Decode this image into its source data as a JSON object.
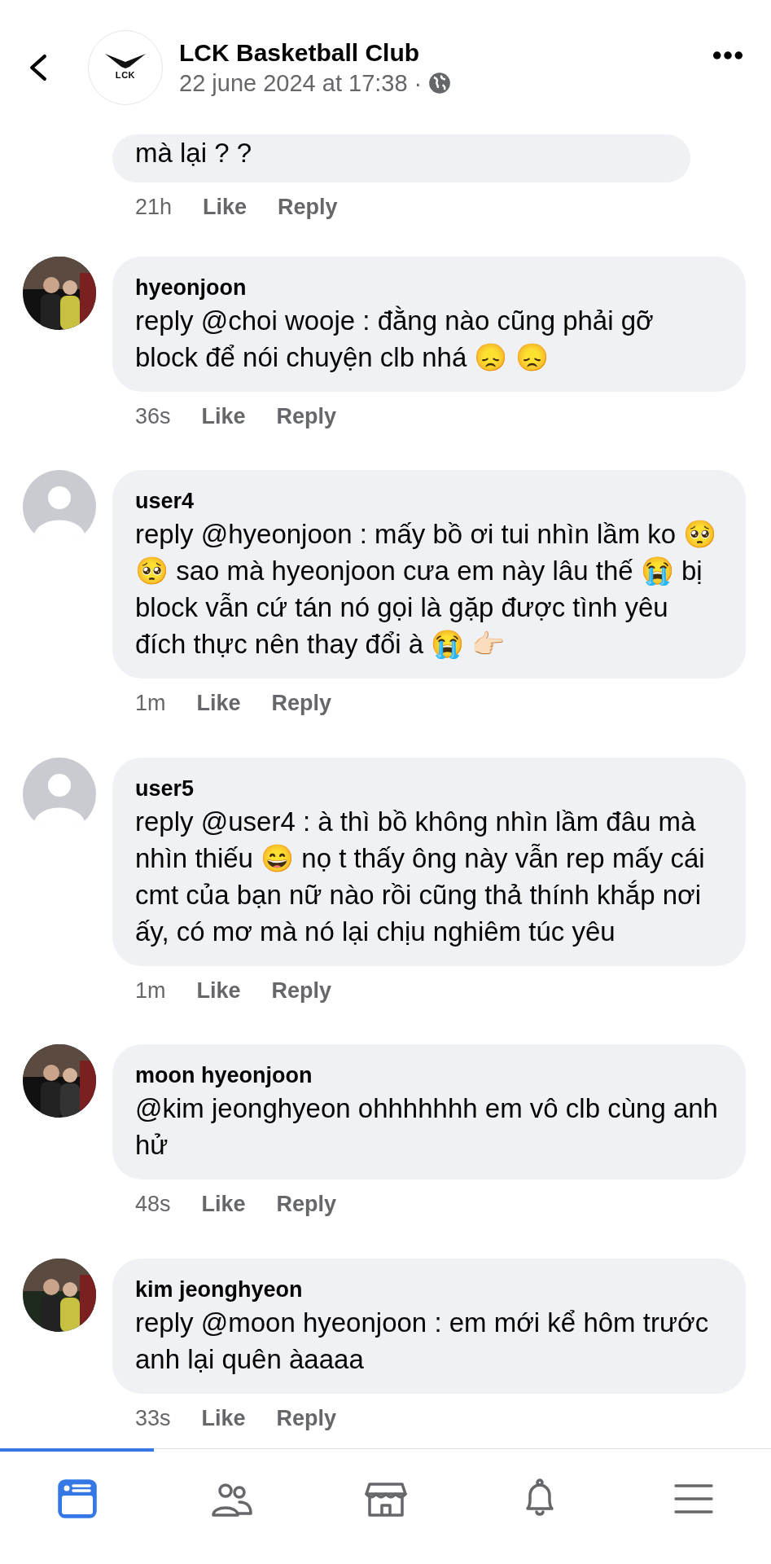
{
  "header": {
    "page_name": "LCK Basketball Club",
    "timestamp": "22 june 2024 at 17:38",
    "separator": "·",
    "logo_text": "LCK"
  },
  "comments": [
    {
      "kind": "continued",
      "text": "mà lại ? ?",
      "time": "21h",
      "like": "Like",
      "reply": "Reply"
    },
    {
      "kind": "photo_avatar",
      "name": "hyeonjoon",
      "text": "reply @choi wooje : đằng nào cũng phải gỡ block để nói chuyện clb nhá 😞 😞",
      "time": "36s",
      "like": "Like",
      "reply": "Reply"
    },
    {
      "kind": "default_avatar",
      "name": "user4",
      "text": "reply @hyeonjoon : mấy bồ ơi tui nhìn lầm ko 🥺 🥺  sao mà hyeonjoon cưa em này lâu thế 😭  bị block vẫn cứ tán nó gọi là gặp được tình yêu đích thực nên thay đổi à 😭 👉🏻",
      "time": "1m",
      "like": "Like",
      "reply": "Reply"
    },
    {
      "kind": "default_avatar",
      "name": "user5",
      "text": "reply @user4 : à thì bồ không nhìn lầm đâu mà nhìn thiếu 😄  nọ t thấy ông này vẫn rep mấy cái cmt của bạn nữ nào rồi cũng thả thính khắp nơi ấy, có mơ mà nó lại chịu nghiêm túc yêu",
      "time": "1m",
      "like": "Like",
      "reply": "Reply"
    },
    {
      "kind": "photo_avatar",
      "name": "moon hyeonjoon",
      "text": "@kim jeonghyeon ohhhhhhh em vô clb cùng anh hử",
      "time": "48s",
      "like": "Like",
      "reply": "Reply"
    },
    {
      "kind": "photo_avatar",
      "name": "kim jeonghyeon",
      "text": "reply @moon hyeonjoon : em mới kể hôm trước anh lại quên àaaaa",
      "time": "33s",
      "like": "Like",
      "reply": "Reply"
    }
  ],
  "tab_bar": [
    {
      "kind": "feed",
      "selected": true
    },
    {
      "kind": "friends",
      "selected": false
    },
    {
      "kind": "marketplace",
      "selected": false
    },
    {
      "kind": "notifications",
      "selected": false
    },
    {
      "kind": "menu",
      "selected": false
    }
  ]
}
